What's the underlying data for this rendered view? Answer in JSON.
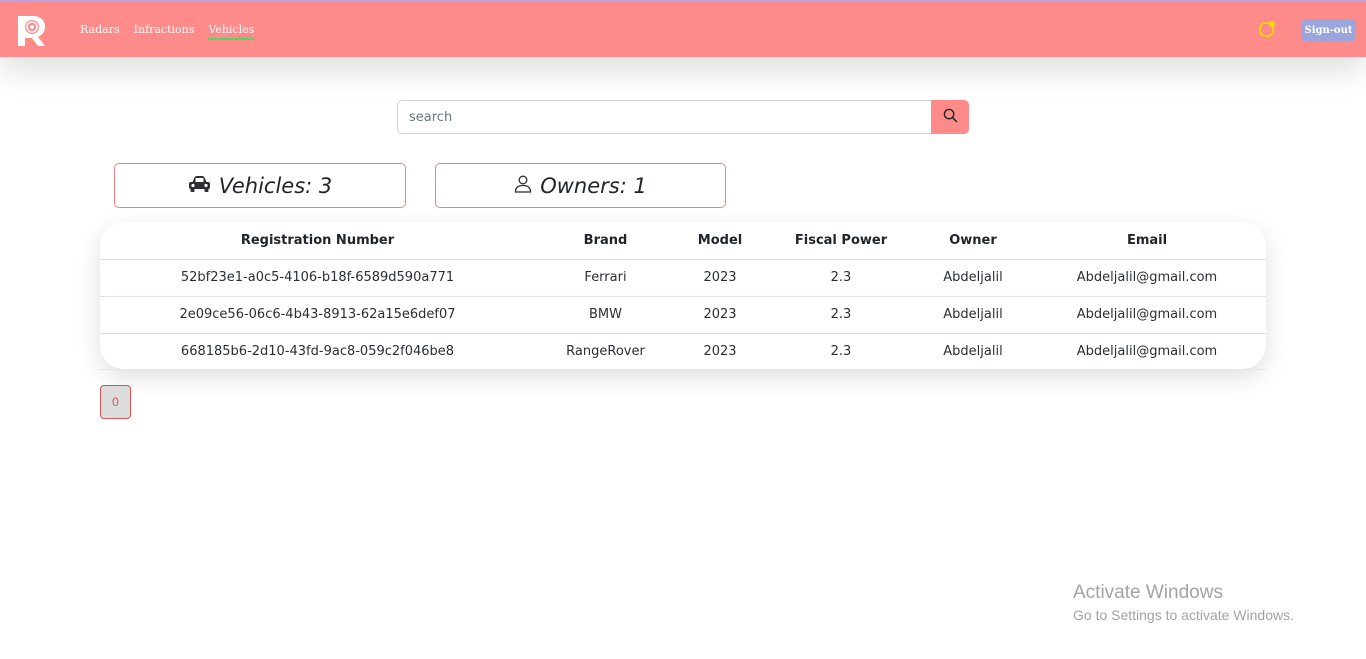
{
  "nav": {
    "links": [
      "Radars",
      "Infractions",
      "Vehicles"
    ],
    "active": "Vehicles",
    "signout_label": "Sign-out"
  },
  "search": {
    "placeholder": "search"
  },
  "stats": {
    "vehicles": "Vehicles: 3",
    "owners": "Owners: 1"
  },
  "table": {
    "headers": [
      "Registration Number",
      "Brand",
      "Model",
      "Fiscal Power",
      "Owner",
      "Email"
    ],
    "rows": [
      [
        "52bf23e1-a0c5-4106-b18f-6589d590a771",
        "Ferrari",
        "2023",
        "2.3",
        "Abdeljalil",
        "Abdeljalil@gmail.com"
      ],
      [
        "2e09ce56-06c6-4b43-8913-62a15e6def07",
        "BMW",
        "2023",
        "2.3",
        "Abdeljalil",
        "Abdeljalil@gmail.com"
      ],
      [
        "668185b6-2d10-43fd-9ac8-059c2f046be8",
        "RangeRover",
        "2023",
        "2.3",
        "Abdeljalil",
        "Abdeljalil@gmail.com"
      ]
    ]
  },
  "pagination": {
    "current": "0"
  },
  "watermark": {
    "title": "Activate Windows",
    "subtitle": "Go to Settings to activate Windows."
  },
  "colors": {
    "navbar": "#ff8a8a",
    "accent": "#ff8a8a",
    "active_underline": "#4cd964",
    "signout_bg": "#9aa5dd",
    "card_border": "#f08080",
    "notif_dot": "#ffd700"
  },
  "icons": {
    "logo": "app-logo-icon",
    "search": "search-icon",
    "vehicles": "car-icon",
    "owners": "person-icon",
    "notification": "notification-icon"
  }
}
